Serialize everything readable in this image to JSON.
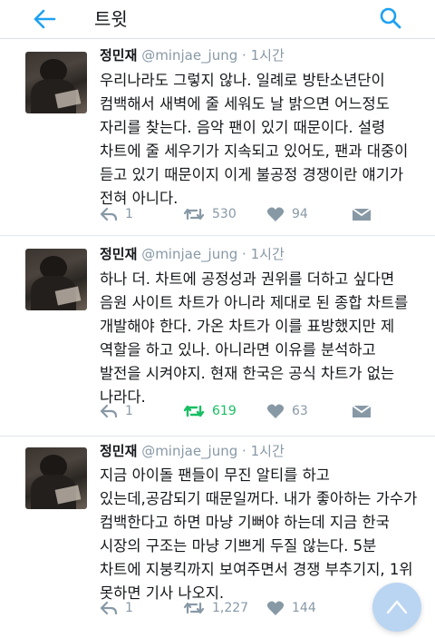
{
  "app_bar": {
    "title": "트윗",
    "back_icon": "arrow-left-icon",
    "search_icon": "search-icon",
    "accent": "#1da1f2"
  },
  "tweets": [
    {
      "name": "정민재",
      "handle": "@minjae_jung",
      "dot": "·",
      "time": "1시간",
      "text": "우리나라도 그렇지 않나. 일례로 방탄소년단이\n컴백해서 새벽에 줄 세워도 날 밝으면 어느정도\n자리를 찾는다. 음악 팬이 있기 때문이다. 설령\n차트에 줄 세우기가 지속되고 있어도, 팬과 대중이\n듣고 있기 때문이지 이게 불공정 경쟁이란 얘기가\n전혀 아니다.",
      "replies": "1",
      "retweets": "530",
      "retweeted": false,
      "likes": "94"
    },
    {
      "name": "정민재",
      "handle": "@minjae_jung",
      "dot": "·",
      "time": "1시간",
      "text": "하나 더. 차트에 공정성과 권위를 더하고 싶다면\n음원 사이트 차트가 아니라 제대로 된 종합 차트를\n개발해야 한다. 가온 차트가 이를 표방했지만 제\n역할을 하고 있나. 아니라면 이유를 분석하고\n발전을 시켜야지. 현재 한국은 공식 차트가 없는\n나라다.",
      "replies": "1",
      "retweets": "619",
      "retweeted": true,
      "likes": "63"
    },
    {
      "name": "정민재",
      "handle": "@minjae_jung",
      "dot": "·",
      "time": "1시간",
      "text": "지금 아이돌 팬들이 무진 알티를 하고\n있는데,공감되기 때문일꺼다. 내가 좋아하는 가수가\n컴백한다고 하면 마냥 기뻐야 하는데 지금 한국\n시장의 구조는 마냥 기쁘게 두질 않는다. 5분\n차트에 지붕킥까지 보여주면서 경쟁 부추기지, 1위\n못하면 기사 나오지.",
      "replies": "1",
      "retweets": "1,227",
      "retweeted": false,
      "likes": "144"
    }
  ],
  "fab": {
    "icon": "chevron-up-icon"
  },
  "colors": {
    "muted": "#8899a6",
    "retweet_active": "#17bf63",
    "text": "#14171a"
  }
}
